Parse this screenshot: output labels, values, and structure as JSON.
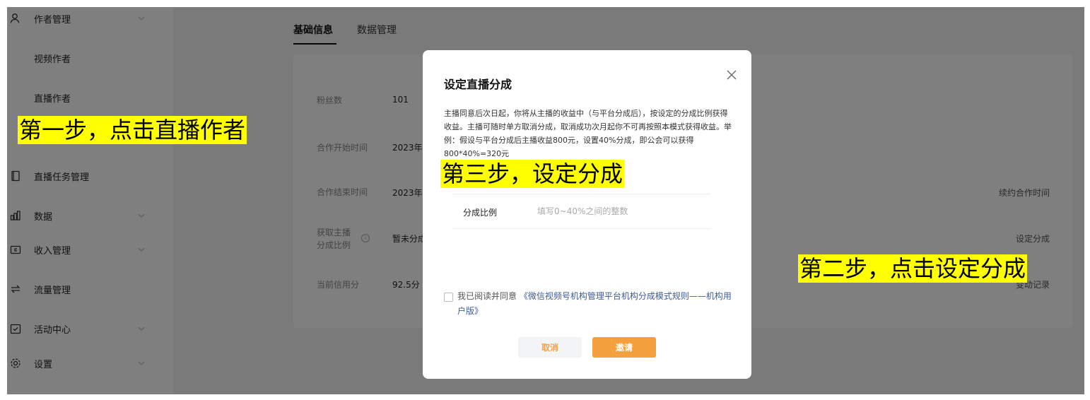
{
  "sidebar": {
    "items": [
      {
        "label": "作者管理",
        "icon": "user-icon",
        "has_chevron": true
      },
      {
        "label": "视频作者",
        "sub": true
      },
      {
        "label": "直播作者",
        "sub": true
      },
      {
        "label": "直播任务管理",
        "icon": "document-icon"
      },
      {
        "label": "数据",
        "icon": "bar-chart-icon",
        "has_chevron": true
      },
      {
        "label": "收入管理",
        "icon": "wallet-icon",
        "has_chevron": true
      },
      {
        "label": "流量管理",
        "icon": "swap-icon"
      },
      {
        "label": "活动中心",
        "icon": "calendar-check-icon",
        "has_chevron": true
      },
      {
        "label": "设置",
        "icon": "gear-icon",
        "has_chevron": true
      }
    ]
  },
  "tabs": [
    {
      "label": "基础信息",
      "active": true
    },
    {
      "label": "数据管理",
      "active": false
    }
  ],
  "info_rows": [
    {
      "label": "粉丝数",
      "value": "101",
      "action": ""
    },
    {
      "label": "合作开始时间",
      "value": "2023年",
      "action": ""
    },
    {
      "label": "合作结束时间",
      "value": "2023年",
      "action": "续约合作时间"
    },
    {
      "label_line1": "获取主播",
      "label_line2": "分成比例",
      "value": "暂未分成",
      "action": "设定分成"
    },
    {
      "label": "当前信用分",
      "value": "92.5分",
      "action": "变动记录"
    }
  ],
  "dialog": {
    "title": "设定直播分成",
    "description": "主播同意后次日起，你将从主播的收益中（与平台分成后），按设定的分成比例获得收益。主播可随时单方取消分成，取消成功次月起你不可再按照本模式获得收益。举例：假设与平台分成后主播收益800元，设置40%分成，即公会可以获得800*40%=320元",
    "field_label": "分成比例",
    "field_placeholder": "填写0~40%之间的整数",
    "agree_prefix": "我已阅读并同意",
    "agree_link": "《微信视频号机构管理平台机构分成模式规则——机构用户版》",
    "cancel_label": "取消",
    "invite_label": "邀请"
  },
  "annotations": {
    "step1": "第一步，点击直播作者",
    "step2": "第二步，点击设定分成",
    "step3": "第三步，设定分成"
  },
  "colors": {
    "accent": "#f5a03e",
    "link": "#3d5b95",
    "highlight": "#ffff00",
    "overlay": "rgba(0,0,0,0.5)"
  }
}
